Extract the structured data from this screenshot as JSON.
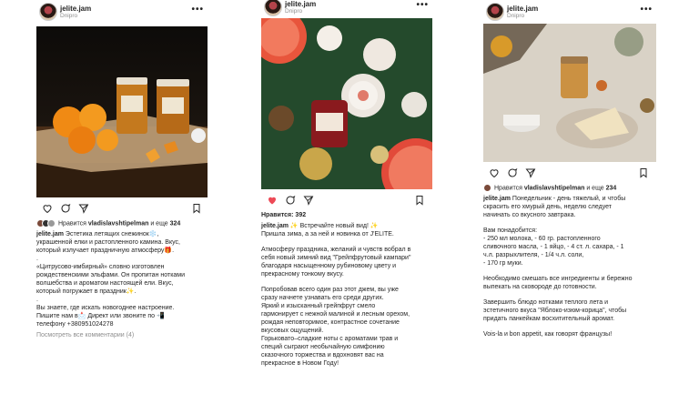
{
  "posts": [
    {
      "username": "jelite.jam",
      "location": "Dnipro",
      "more": "•••",
      "likes_prefix": "Нравится ",
      "likes_user": "vladislavshtipelman",
      "likes_mid": " и еще ",
      "likes_count": "324",
      "caption_user": "jelite.jam",
      "caption_lines": [
        " Эстетика летящих снежинок❄️,",
        "украшенной елки и растопленного камина. Вкус,",
        "который излучает праздничную атмосферу🎁.",
        ".",
        "«Цитрусово-имбирный» словно изготовлен",
        "рождественскими эльфами. Он пропитан нотками",
        "волшебства и ароматом настоящей ели. Вкус,",
        "который погружает в праздник✨.",
        ".",
        "Вы знаете, где искать новогоднее настроение.",
        "Пишите нам в📩 Директ или звоните по 📲",
        "телефону +380951024278"
      ],
      "comments_link": "Посмотреть все комментарии (4)"
    },
    {
      "username": "jelite.jam",
      "location": "Dnipro",
      "more": "•••",
      "likes_label": "Нравится: 392",
      "caption_user": "jelite.jam",
      "caption_first": " ✨ Встречайте новый вид! ✨",
      "caption_lines": [
        "Пришла зима, а за ней и новинка от J'ELITE.",
        "Атмосферу праздника, желаний и чувств вобрал в",
        "себя новый зимний вид \"Грейпфрутовый кампари\"",
        "благодаря насыщенному рубиновому цвету и",
        "прекрасному тонкому вкусу.",
        "Попробовав всего один раз этот джем, вы уже",
        "сразу начнете узнавать его среди других.",
        "Яркий и изысканный грейпфрут смело",
        "гармонирует с нежной малиной и лесным орехом,",
        "рождая неповторимое, контрастное сочетание",
        "вкусовых ощущений.",
        "Горьковато–сладкие ноты с ароматами трав и",
        "специй сыграют необычайную симфонию",
        "сказочного торжества и вдохновят вас на",
        "прекрасное в Новом Году!"
      ]
    },
    {
      "username": "jelite.jam",
      "location": "Dnipro",
      "more": "•••",
      "likes_prefix": "Нравится ",
      "likes_user": "vladislavshtipelman",
      "likes_mid": " и еще ",
      "likes_count": "234",
      "caption_user": "jelite.jam",
      "caption_lines": [
        " Понедельник - день тяжелый, и чтобы",
        "скрасить его хмурый день, неделю следует",
        "начинать со вкусного завтрака.",
        "Вам понадобится:",
        "- 250 мл молока, - 60 гр. растопленного",
        "сливочного масла, - 1 яйцо, - 4 ст. л. сахара, - 1",
        "ч.л. разрыхлителя, - 1/4 ч.л. соли,",
        "- 170 гр муки.",
        "Необходимо смешать все ингредиенты и бережно",
        "выпекать на сковороде до готовности.",
        "Завершить блюдо нотками теплого лета и",
        "эстетичного вкуса \"Яблоко-изюм-корица\", чтобы",
        "придать панкейкам восхитительный аромат.",
        "Vois-la и bon appetit, как говорят французы!"
      ]
    }
  ],
  "colors": {
    "like_red": "#ed4956",
    "muted": "#8e8e8e"
  }
}
